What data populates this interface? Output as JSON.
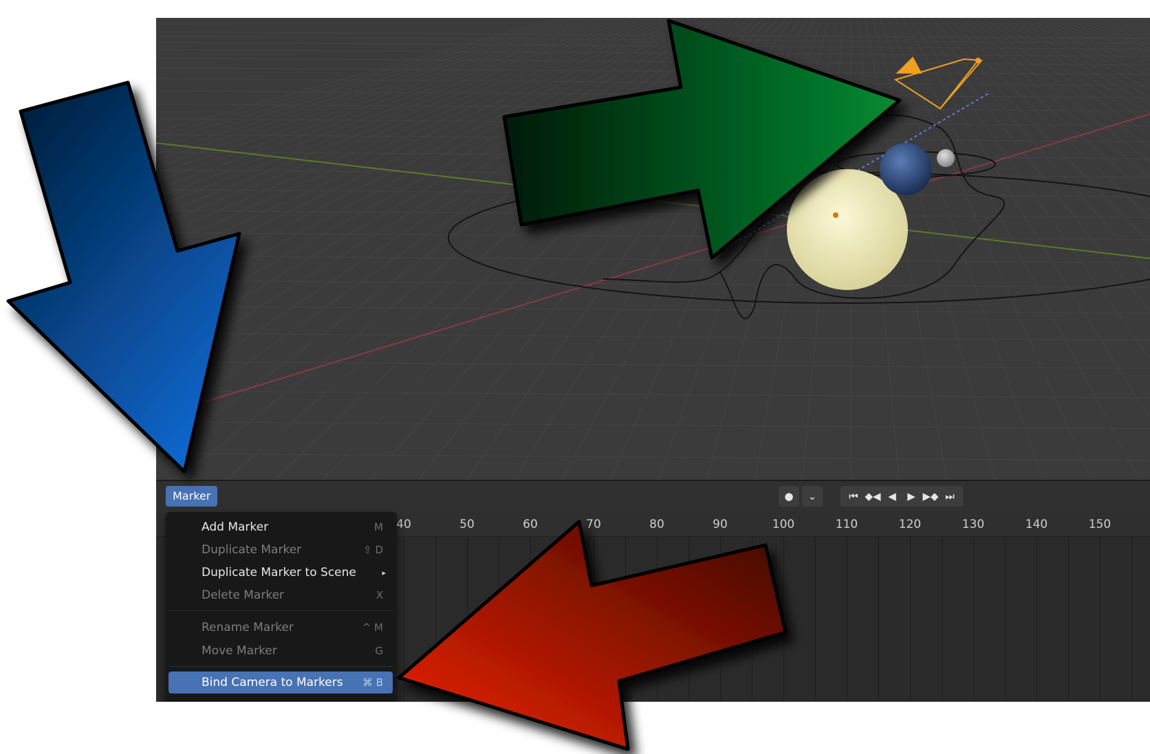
{
  "timeline": {
    "menu_button": "Marker",
    "frame_labels": [
      "40",
      "50",
      "60",
      "70",
      "80",
      "90",
      "100",
      "110",
      "120",
      "130",
      "140",
      "150"
    ],
    "playback_icons": [
      "record-icon",
      "chevron-down-icon",
      "jump-to-start-icon",
      "prev-keyframe-icon",
      "play-reverse-icon",
      "play-icon",
      "next-keyframe-icon",
      "jump-to-end-icon"
    ],
    "playback_glyphs": {
      "record": "●",
      "dropdown": "⌄",
      "jump_start": "⏮",
      "prev_key": "◆◀",
      "play_reverse": "◀",
      "play": "▶",
      "next_key": "▶◆",
      "jump_end": "⏭"
    }
  },
  "marker_menu": {
    "items": [
      {
        "label": "Add Marker",
        "shortcut": "M",
        "state": "enabled"
      },
      {
        "label": "Duplicate Marker",
        "shortcut": "⇧ D",
        "state": "disabled"
      },
      {
        "label": "Duplicate Marker to Scene",
        "shortcut": "▸",
        "state": "enabled"
      },
      {
        "label": "Delete Marker",
        "shortcut": "X",
        "state": "disabled"
      },
      {
        "label": "Rename Marker",
        "shortcut": "^ M",
        "state": "disabled"
      },
      {
        "label": "Move Marker",
        "shortcut": "G",
        "state": "disabled"
      },
      {
        "label": "Bind Camera to Markers",
        "shortcut": "⌘ B",
        "state": "highlighted"
      }
    ]
  },
  "annotation_arrows": [
    {
      "color": "blue",
      "points_to": "marker-menu-button"
    },
    {
      "color": "green",
      "points_to": "camera"
    },
    {
      "color": "red",
      "points_to": "bind-camera-to-markers"
    }
  ],
  "colors": {
    "accent": "#4772b3",
    "viewport_bg": "#3b3b3b",
    "sun": "#f2eec0",
    "earth": "#2d4f86",
    "camera": "#f0a020",
    "arrow_blue": "#0a5fc4",
    "arrow_green": "#068a30",
    "arrow_red": "#ee2200"
  }
}
